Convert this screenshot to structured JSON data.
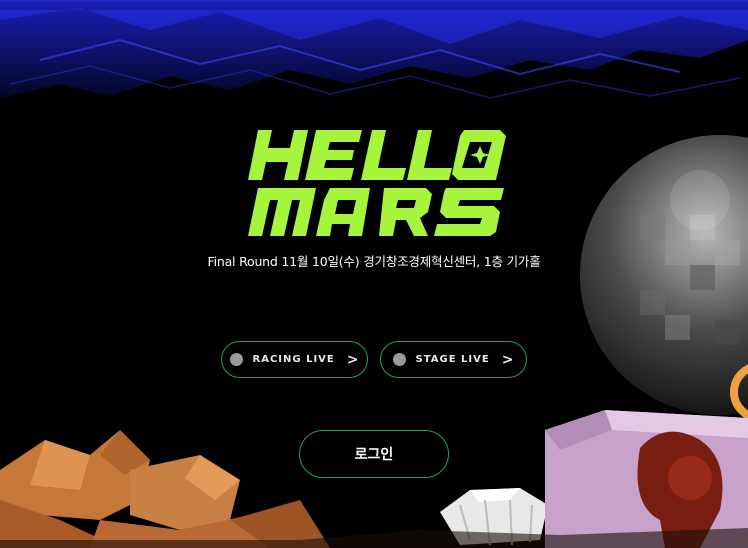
{
  "hero": {
    "logo_text": "HELLO MARS",
    "subtitle": "Final Round 11월 10일(수) 경기창조경제혁신센터, 1층 기가홀"
  },
  "live_buttons": [
    {
      "label": "RACING LIVE",
      "icon": "status-dot-icon",
      "arrow": "chevron-right-icon",
      "chevron": ">"
    },
    {
      "label": "STAGE LIVE",
      "icon": "status-dot-icon",
      "arrow": "chevron-right-icon",
      "chevron": ">"
    }
  ],
  "login": {
    "label": "로그인"
  },
  "colors": {
    "background": "#000000",
    "logo_green": "#a6f53c",
    "button_border": "#2d9a55",
    "status_dot": "#9a9a9a",
    "rock": "#c77a3c",
    "box": "#d9b8dc",
    "sky": "#1b22c8"
  }
}
